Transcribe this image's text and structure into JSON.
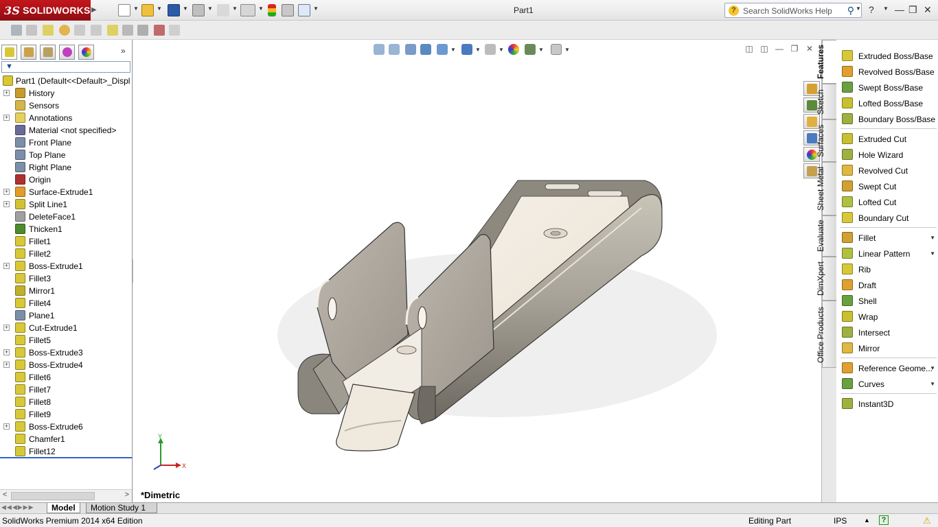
{
  "app": {
    "logo_text": "SOLIDWORKS",
    "logo_prefix": "3S",
    "document_title": "Part1",
    "search_placeholder": "Search SolidWorks Help",
    "accent_color": "#c4161c"
  },
  "left_panel": {
    "tree_root": "Part1  (Default<<Default>_Displ",
    "items": [
      {
        "label": "History",
        "icon": "history-icon",
        "color": "#c79a2c",
        "expandable": true
      },
      {
        "label": "Sensors",
        "icon": "sensors-icon",
        "color": "#d5b54a",
        "expandable": false
      },
      {
        "label": "Annotations",
        "icon": "annotations-icon",
        "color": "#e6d05c",
        "expandable": true
      },
      {
        "label": "Material <not specified>",
        "icon": "material-icon",
        "color": "#6a6a9a",
        "expandable": false
      },
      {
        "label": "Front Plane",
        "icon": "plane-icon",
        "color": "#7c8fa8",
        "expandable": false
      },
      {
        "label": "Top Plane",
        "icon": "plane-icon",
        "color": "#7c8fa8",
        "expandable": false
      },
      {
        "label": "Right Plane",
        "icon": "plane-icon",
        "color": "#7c8fa8",
        "expandable": false
      },
      {
        "label": "Origin",
        "icon": "origin-icon",
        "color": "#b03030",
        "expandable": false
      },
      {
        "label": "Surface-Extrude1",
        "icon": "surface-extrude-icon",
        "color": "#e39b2c",
        "expandable": true
      },
      {
        "label": "Split Line1",
        "icon": "split-line-icon",
        "color": "#d2c232",
        "expandable": true
      },
      {
        "label": "DeleteFace1",
        "icon": "delete-face-icon",
        "color": "#a0a0a0",
        "expandable": false
      },
      {
        "label": "Thicken1",
        "icon": "thicken-icon",
        "color": "#4f8a2e",
        "expandable": false
      },
      {
        "label": "Fillet1",
        "icon": "fillet-icon",
        "color": "#d8c838",
        "expandable": false
      },
      {
        "label": "Fillet2",
        "icon": "fillet-icon",
        "color": "#d8c838",
        "expandable": false
      },
      {
        "label": "Boss-Extrude1",
        "icon": "boss-extrude-icon",
        "color": "#d8c838",
        "expandable": true
      },
      {
        "label": "Fillet3",
        "icon": "fillet-icon",
        "color": "#d8c838",
        "expandable": false
      },
      {
        "label": "Mirror1",
        "icon": "mirror-icon",
        "color": "#c2b02a",
        "expandable": false
      },
      {
        "label": "Fillet4",
        "icon": "fillet-icon",
        "color": "#d8c838",
        "expandable": false
      },
      {
        "label": "Plane1",
        "icon": "plane-icon",
        "color": "#7c8fa8",
        "expandable": false
      },
      {
        "label": "Cut-Extrude1",
        "icon": "cut-extrude-icon",
        "color": "#d8c838",
        "expandable": true
      },
      {
        "label": "Fillet5",
        "icon": "fillet-icon",
        "color": "#d8c838",
        "expandable": false
      },
      {
        "label": "Boss-Extrude3",
        "icon": "boss-extrude-icon",
        "color": "#d8c838",
        "expandable": true
      },
      {
        "label": "Boss-Extrude4",
        "icon": "boss-extrude-icon",
        "color": "#d8c838",
        "expandable": true
      },
      {
        "label": "Fillet6",
        "icon": "fillet-icon",
        "color": "#d8c838",
        "expandable": false
      },
      {
        "label": "Fillet7",
        "icon": "fillet-icon",
        "color": "#d8c838",
        "expandable": false
      },
      {
        "label": "Fillet8",
        "icon": "fillet-icon",
        "color": "#d8c838",
        "expandable": false
      },
      {
        "label": "Fillet9",
        "icon": "fillet-icon",
        "color": "#d8c838",
        "expandable": false
      },
      {
        "label": "Boss-Extrude6",
        "icon": "boss-extrude-icon",
        "color": "#d8c838",
        "expandable": true
      },
      {
        "label": "Chamfer1",
        "icon": "chamfer-icon",
        "color": "#d8c838",
        "expandable": false
      },
      {
        "label": "Fillet12",
        "icon": "fillet-icon",
        "color": "#d8c838",
        "expandable": false
      }
    ]
  },
  "viewport": {
    "view_orientation": "*Dimetric",
    "triad": {
      "x": "X",
      "y": "Y"
    }
  },
  "vertical_tabs": [
    "Features",
    "Sketch",
    "Surfaces",
    "Sheet Metal",
    "Evaluate",
    "DimXpert",
    "Office Products"
  ],
  "features": {
    "groups": [
      [
        {
          "label": "Extruded Boss/Base",
          "icon": "extruded-boss-icon"
        },
        {
          "label": "Revolved Boss/Base",
          "icon": "revolved-boss-icon"
        },
        {
          "label": "Swept Boss/Base",
          "icon": "swept-boss-icon"
        },
        {
          "label": "Lofted Boss/Base",
          "icon": "lofted-boss-icon"
        },
        {
          "label": "Boundary Boss/Base",
          "icon": "boundary-boss-icon"
        }
      ],
      [
        {
          "label": "Extruded Cut",
          "icon": "extruded-cut-icon"
        },
        {
          "label": "Hole Wizard",
          "icon": "hole-wizard-icon"
        },
        {
          "label": "Revolved Cut",
          "icon": "revolved-cut-icon"
        },
        {
          "label": "Swept Cut",
          "icon": "swept-cut-icon"
        },
        {
          "label": "Lofted Cut",
          "icon": "lofted-cut-icon"
        },
        {
          "label": "Boundary Cut",
          "icon": "boundary-cut-icon"
        }
      ],
      [
        {
          "label": "Fillet",
          "icon": "fillet-icon",
          "dropdown": true
        },
        {
          "label": "Linear Pattern",
          "icon": "linear-pattern-icon",
          "dropdown": true
        },
        {
          "label": "Rib",
          "icon": "rib-icon"
        },
        {
          "label": "Draft",
          "icon": "draft-icon"
        },
        {
          "label": "Shell",
          "icon": "shell-icon"
        },
        {
          "label": "Wrap",
          "icon": "wrap-icon"
        },
        {
          "label": "Intersect",
          "icon": "intersect-icon"
        },
        {
          "label": "Mirror",
          "icon": "mirror-icon"
        }
      ],
      [
        {
          "label": "Reference Geome...",
          "icon": "reference-geometry-icon",
          "dropdown": true
        },
        {
          "label": "Curves",
          "icon": "curves-icon",
          "dropdown": true
        }
      ],
      [
        {
          "label": "Instant3D",
          "icon": "instant3d-icon"
        }
      ]
    ]
  },
  "bottom_tabs": [
    "Model",
    "Motion Study 1"
  ],
  "status": {
    "product": "SolidWorks Premium 2014 x64 Edition",
    "mode": "Editing Part",
    "units": "IPS",
    "help": "?"
  }
}
